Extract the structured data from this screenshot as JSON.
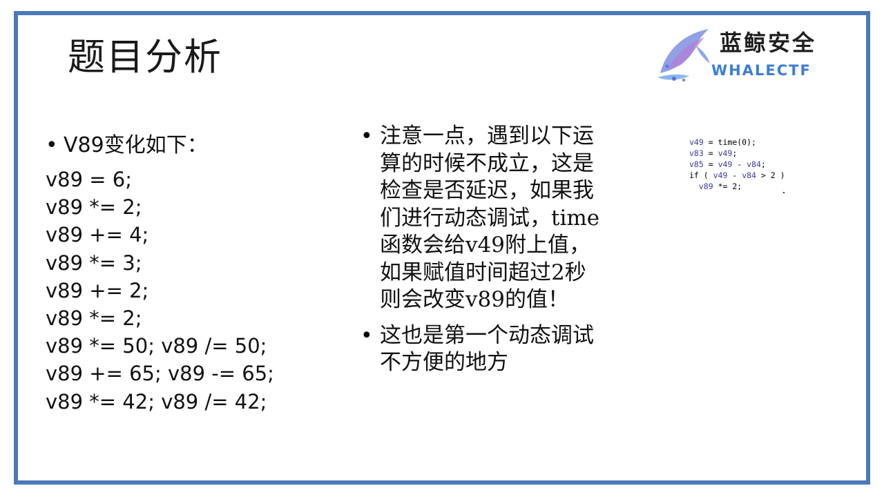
{
  "slide": {
    "title": "题目分析",
    "logo": {
      "name_cn": "蓝鲸安全",
      "name_en": "WHALECTF"
    },
    "left": {
      "heading": "V89变化如下：",
      "code_lines": [
        "v89 = 6;",
        "v89 *= 2;",
        "v89 += 4;",
        "v89 *= 3;",
        "v89 += 2;",
        "v89 *= 2;",
        "v89 *= 50; v89 /= 50;",
        "v89 += 65; v89 -= 65;",
        "v89 *= 42; v89 /= 42;"
      ]
    },
    "middle": {
      "bullets": [
        "注意一点，遇到以下运\n算的时候不成立，这是\n检查是否延迟，如果我\n们进行动态调试，time\n函数会给v49附上值，\n如果赋值时间超过2秒\n则会改变v89的值！",
        "这也是第一个动态调试\n不方便的地方"
      ]
    },
    "code_snippet": {
      "line1": {
        "var": "v49",
        "rest": " = time(0);"
      },
      "line2": {
        "var": "v83",
        "mid": " = ",
        "var2": "v49",
        "end": ";"
      },
      "line3": {
        "var": "v85",
        "mid": " = ",
        "var2": "v49",
        "op": " - ",
        "var3": "v84",
        "end": ";"
      },
      "line4": {
        "kw": "if ( ",
        "var": "v49",
        "op": " - ",
        "var2": "v84",
        "end": " > 2 )"
      },
      "line5": {
        "indent": "  ",
        "var": "v89",
        "rest": " *= 2;"
      }
    },
    "colors": {
      "frame": "#4a79b8",
      "logo_text": "#3b7dd8",
      "code_var": "#3a3aa8"
    }
  }
}
